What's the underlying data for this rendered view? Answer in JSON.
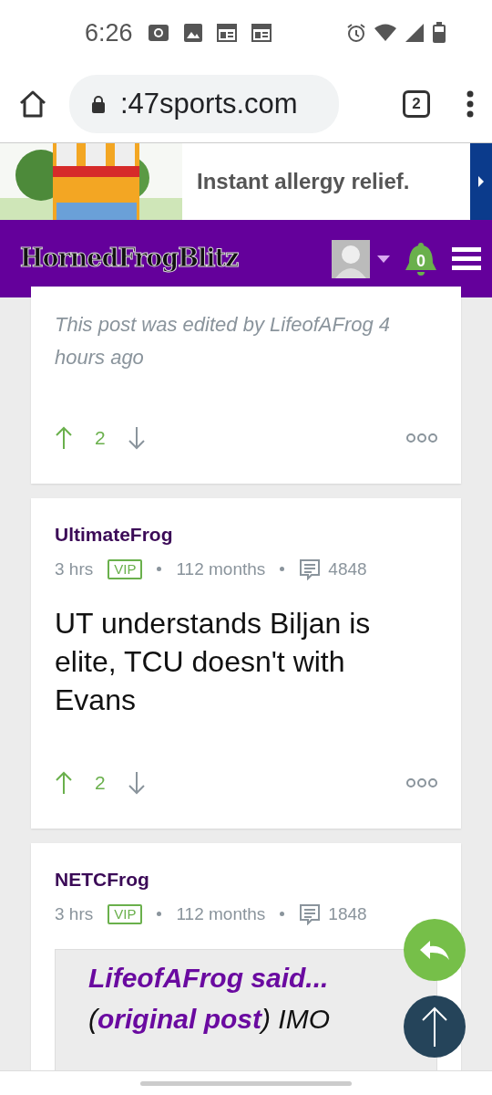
{
  "status_bar": {
    "time": "6:26"
  },
  "browser": {
    "url": ":47sports.com",
    "tab_count": "2"
  },
  "ad": {
    "kind": "picture",
    "headline": "Instant allergy relief."
  },
  "site_header": {
    "logo": "HornedFrogBlitz",
    "notification_count": "0"
  },
  "posts": [
    {
      "kind": "partial",
      "edit_note": "This post was edited by LifeofAFrog 4 hours ago",
      "votes": "2"
    },
    {
      "kind": "full",
      "author": "UltimateFrog",
      "time": "3 hrs",
      "badge": "VIP",
      "tenure": "112 months",
      "post_count": "4848",
      "body": "UT understands Biljan is elite, TCU doesn't with Evans",
      "votes": "2"
    },
    {
      "kind": "quote",
      "author": "NETCFrog",
      "time": "3 hrs",
      "badge": "VIP",
      "tenure": "112 months",
      "post_count": "1848",
      "quote_author": "LifeofAFrog said...",
      "quote_text": "(**original post**) IMO"
    }
  ]
}
